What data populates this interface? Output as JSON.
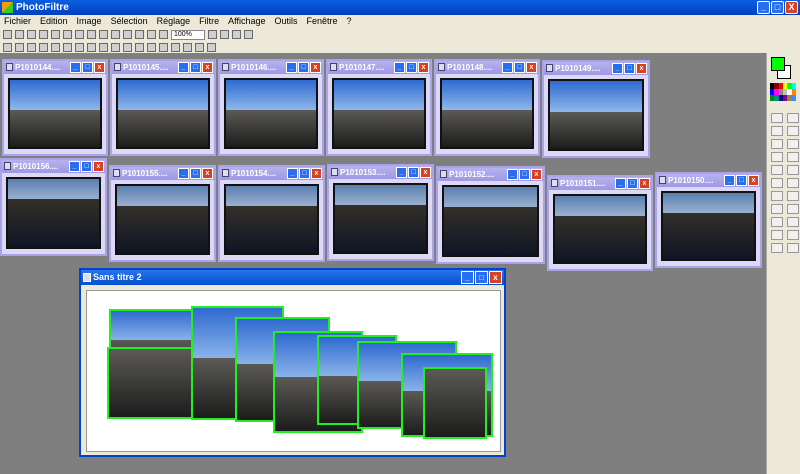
{
  "app": {
    "title": "PhotoFiltre"
  },
  "window_controls": {
    "min": "_",
    "max": "□",
    "close": "X"
  },
  "menu": [
    "Fichier",
    "Edition",
    "Image",
    "Sélection",
    "Réglage",
    "Filtre",
    "Affichage",
    "Outils",
    "Fenêtre",
    "?"
  ],
  "toolbar": {
    "zoom": "100%"
  },
  "thumbs_row1": [
    "P1010144....",
    "P1010145....",
    "P1010146....",
    "P1010147....",
    "P1010148....",
    "P1010149...."
  ],
  "thumbs_row2": [
    "P1010156....",
    "P1010155....",
    "P1010154....",
    "P1010153....",
    "P1010152....",
    "P1010151....",
    "P1010150...."
  ],
  "main_window": {
    "title": "Sans titre 2"
  },
  "colors": {
    "foreground": "#00ff00",
    "background": "#ffffff",
    "selection": "#22ee22"
  }
}
